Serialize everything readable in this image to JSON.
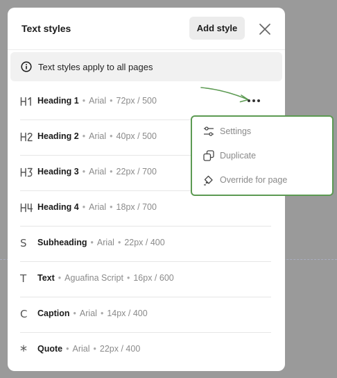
{
  "header": {
    "title": "Text styles",
    "add_label": "Add style"
  },
  "info": {
    "text": "Text styles apply to all pages"
  },
  "styles": [
    {
      "name": "Heading 1",
      "font": "Arial",
      "spec": "72px / 500",
      "icon": "h1-icon"
    },
    {
      "name": "Heading 2",
      "font": "Arial",
      "spec": "40px / 500",
      "icon": "h2-icon"
    },
    {
      "name": "Heading 3",
      "font": "Arial",
      "spec": "22px / 700",
      "icon": "h3-icon"
    },
    {
      "name": "Heading 4",
      "font": "Arial",
      "spec": "18px / 700",
      "icon": "h4-icon"
    },
    {
      "name": "Subheading",
      "font": "Arial",
      "spec": "22px / 400",
      "icon": "subheading-icon",
      "glyph": "S"
    },
    {
      "name": "Text",
      "font": "Aguafina Script",
      "spec": "16px / 600",
      "icon": "text-icon",
      "glyph": "T"
    },
    {
      "name": "Caption",
      "font": "Arial",
      "spec": "14px / 400",
      "icon": "caption-icon",
      "glyph": "C"
    },
    {
      "name": "Quote",
      "font": "Arial",
      "spec": "22px / 400",
      "icon": "asterisk-icon",
      "glyph": "*"
    }
  ],
  "separator": "•",
  "menu": {
    "items": [
      {
        "label": "Settings",
        "icon": "sliders-icon"
      },
      {
        "label": "Duplicate",
        "icon": "duplicate-icon"
      },
      {
        "label": "Override for page",
        "icon": "paint-bucket-icon"
      }
    ]
  },
  "colors": {
    "accent": "#5c9a52",
    "overlay": "#9a9a9a"
  }
}
